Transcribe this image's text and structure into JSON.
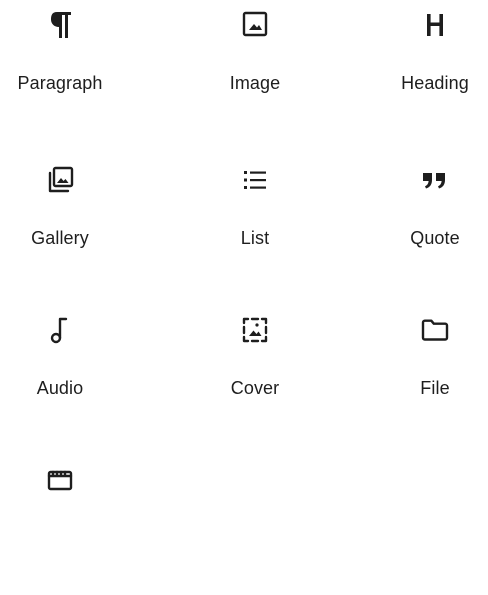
{
  "blocks": [
    {
      "label": "Paragraph",
      "icon": "paragraph-icon"
    },
    {
      "label": "Image",
      "icon": "image-icon"
    },
    {
      "label": "Heading",
      "icon": "heading-icon"
    },
    {
      "label": "Gallery",
      "icon": "gallery-icon"
    },
    {
      "label": "List",
      "icon": "list-icon"
    },
    {
      "label": "Quote",
      "icon": "quote-icon"
    },
    {
      "label": "Audio",
      "icon": "audio-icon"
    },
    {
      "label": "Cover",
      "icon": "cover-icon"
    },
    {
      "label": "File",
      "icon": "file-icon"
    },
    {
      "label": "",
      "icon": "video-icon"
    }
  ],
  "colors": {
    "text": "#1e1e1e",
    "background": "#ffffff"
  }
}
